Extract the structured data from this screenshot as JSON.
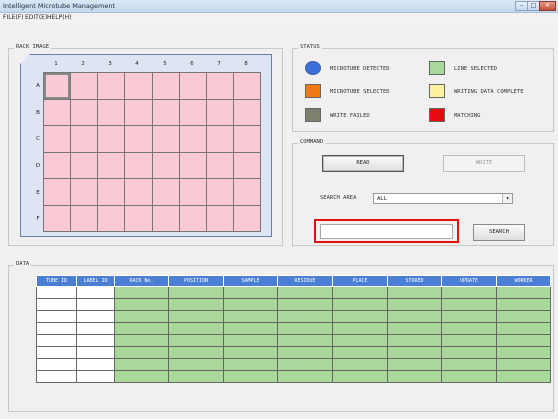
{
  "window": {
    "title": "Intelligent Microtube Management",
    "min": "–",
    "max": "□",
    "close": "✕"
  },
  "menu": [
    {
      "label": "FILE(F)"
    },
    {
      "label": "EDIT(E)"
    },
    {
      "label": "HELP(H)"
    }
  ],
  "rack": {
    "group_label": "RACK IMAGE",
    "columns": [
      "1",
      "2",
      "3",
      "4",
      "5",
      "6",
      "7",
      "8"
    ],
    "rows": [
      "A",
      "B",
      "C",
      "D",
      "E",
      "F"
    ],
    "cell_color": "#f9c9d6",
    "selected_cell": "A1"
  },
  "status": {
    "group_label": "STATUS",
    "legend": [
      {
        "label": "MICROTUBE DETECTED",
        "color": "#3d6fd8",
        "shape": "circle"
      },
      {
        "label": "LINE SELECTED",
        "color": "#a8d89a",
        "shape": "square"
      },
      {
        "label": "MICROTUBE SELECTED",
        "color": "#f07a10",
        "shape": "square"
      },
      {
        "label": "WRITING DATA COMPLETE",
        "color": "#fff3a0",
        "shape": "square"
      },
      {
        "label": "WRITE FAILED",
        "color": "#7f7f6f",
        "shape": "square"
      },
      {
        "label": "MATCHING",
        "color": "#e80c0c",
        "shape": "square"
      }
    ]
  },
  "command": {
    "group_label": "COMMAND",
    "read_label": "READ",
    "write_label": "WRITE",
    "search_area_label": "SEARCH AREA",
    "search_area_value": "ALL",
    "search_value": "",
    "search_label": "SEARCH"
  },
  "data": {
    "group_label": "DATA",
    "columns": [
      "TUBE ID",
      "LABEL ID",
      "RACK No.",
      "POSITION",
      "SAMPLE",
      "RESIDUE",
      "PLACE",
      "STORED",
      "UPDATE",
      "WORKER"
    ],
    "row_count": 8
  }
}
